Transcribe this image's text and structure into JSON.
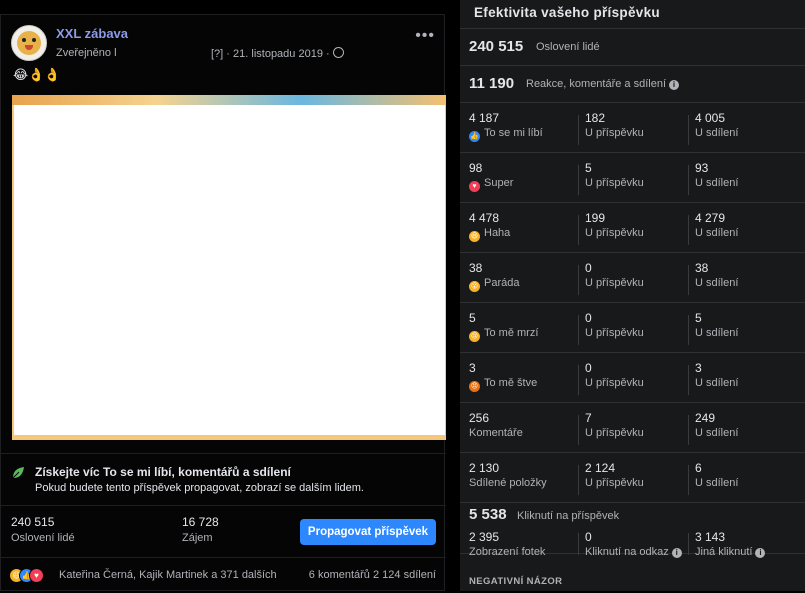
{
  "post": {
    "page_name": "XXL zábava",
    "published_by": "Zveřejněno l",
    "help_mark": "[?]",
    "date": "21. listopadu 2019",
    "emojis": "😂👌👌"
  },
  "boost": {
    "title": "Získejte víc To se mi líbí, komentářů a sdílení",
    "description": "Pokud budete tento příspěvek propagovat, zobrazí se dalším lidem."
  },
  "stats": {
    "reach_value": "240 515",
    "reach_label": "Oslovení lidé",
    "engagement_value": "16 728",
    "engagement_label": "Zájem",
    "promote_label": "Propagovat příspěvek"
  },
  "reactions_bar": {
    "names": "Kateřina Černá, Kajik Martinek a 371 dalších",
    "comments": "6 komentářů",
    "shares": "2 124 sdílení"
  },
  "panel": {
    "title": "Efektivita vašeho příspěvku",
    "reach_value": "240 515",
    "reach_label": "Oslovení lidé",
    "engagement_value": "11 190",
    "engagement_label": "Reakce, komentáře a sdílení",
    "rows": [
      {
        "total": "4 187",
        "label": "To se mi líbí",
        "on_post": "182",
        "on_post_label": "U příspěvku",
        "on_shares": "4 005",
        "on_shares_label": "U sdílení",
        "icon": "like-icon",
        "color": "#2d88ff",
        "glyph": "👍"
      },
      {
        "total": "98",
        "label": "Super",
        "on_post": "5",
        "on_post_label": "U příspěvku",
        "on_shares": "93",
        "on_shares_label": "U sdílení",
        "icon": "love-icon",
        "color": "#f33e58",
        "glyph": "♥"
      },
      {
        "total": "4 478",
        "label": "Haha",
        "on_post": "199",
        "on_post_label": "U příspěvku",
        "on_shares": "4 279",
        "on_shares_label": "U sdílení",
        "icon": "haha-icon",
        "color": "#f7b125",
        "glyph": "😆"
      },
      {
        "total": "38",
        "label": "Paráda",
        "on_post": "0",
        "on_post_label": "U příspěvku",
        "on_shares": "38",
        "on_shares_label": "U sdílení",
        "icon": "wow-icon",
        "color": "#f7b125",
        "glyph": "😮"
      },
      {
        "total": "5",
        "label": "To mě mrzí",
        "on_post": "0",
        "on_post_label": "U příspěvku",
        "on_shares": "5",
        "on_shares_label": "U sdílení",
        "icon": "sad-icon",
        "color": "#f7b125",
        "glyph": "😢"
      },
      {
        "total": "3",
        "label": "To mě štve",
        "on_post": "0",
        "on_post_label": "U příspěvku",
        "on_shares": "3",
        "on_shares_label": "U sdílení",
        "icon": "angry-icon",
        "color": "#e9710f",
        "glyph": "😠"
      },
      {
        "total": "256",
        "label": "Komentáře",
        "on_post": "7",
        "on_post_label": "U příspěvku",
        "on_shares": "249",
        "on_shares_label": "U sdílení",
        "icon": "",
        "color": "",
        "glyph": ""
      },
      {
        "total": "2 130",
        "label": "Sdílené položky",
        "on_post": "2 124",
        "on_post_label": "U příspěvku",
        "on_shares": "6",
        "on_shares_label": "U sdílení",
        "icon": "",
        "color": "",
        "glyph": ""
      }
    ],
    "clicks_value": "5 538",
    "clicks_label": "Kliknutí na příspěvek",
    "photo_views_value": "2 395",
    "photo_views_label": "Zobrazení fotek",
    "link_clicks_value": "0",
    "link_clicks_label": "Kliknutí na odkaz",
    "other_clicks_value": "3 143",
    "other_clicks_label": "Jiná kliknutí",
    "negative_label": "NEGATIVNÍ NÁZOR"
  }
}
